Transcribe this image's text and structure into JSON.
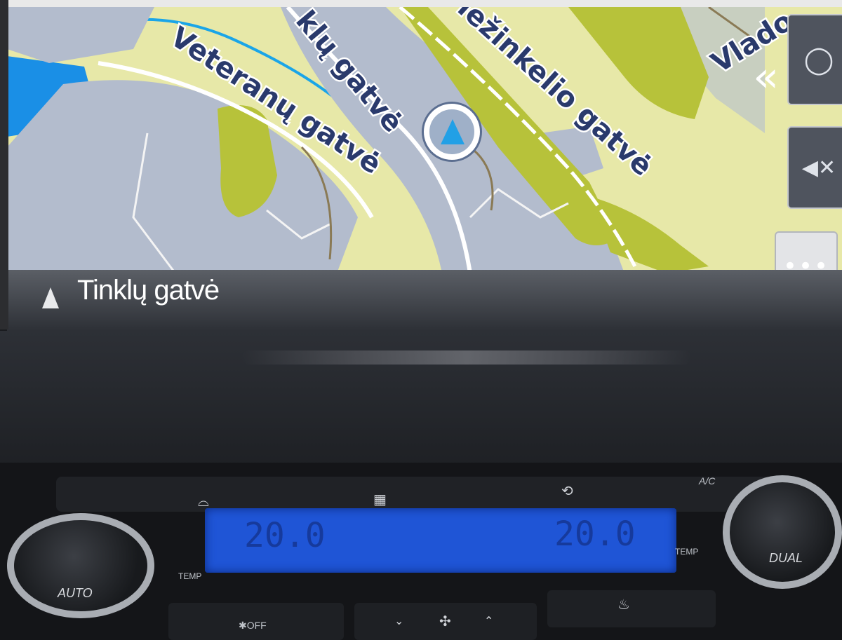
{
  "map": {
    "streets": [
      "Veteranų gatvė",
      "Tinklų gatvė",
      "Geležinkelio gatvė",
      "Vlado"
    ],
    "visible_labels": {
      "veteranu": "Veteranų gatvė",
      "tinklu_partial": "klų gatvė",
      "gelezinkelio_partial": "ležinkelio gatvė",
      "vlado_partial": "Vlado"
    },
    "current_street": "Tinklų gatvė"
  },
  "sidebar": {
    "collapse_icon": "double-chevron-left-icon",
    "compass_icon": "compass-icon",
    "mute_icon": "speaker-mute-icon",
    "more_label": "•••"
  },
  "climate": {
    "temp_left": "20.0",
    "temp_right": "20.0",
    "labels": {
      "auto": "AUTO",
      "dual": "DUAL",
      "ac": "A/C",
      "off": "✱OFF",
      "temp": "TEMP"
    }
  },
  "colors": {
    "map_background": "#e7e8a8",
    "built_area": "#b3bccd",
    "park": "#b7c23a",
    "water": "#1a8fe6",
    "lcd": "#1f55d6",
    "position_arrow": "#22a0e6"
  }
}
